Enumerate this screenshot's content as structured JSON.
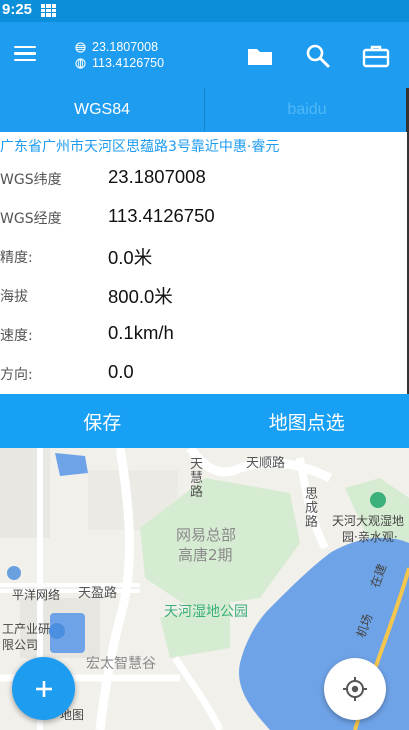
{
  "status_bar": {
    "time": "9:25"
  },
  "app_bar": {
    "latitude": "23.1807008",
    "longitude": "113.4126750",
    "icons": [
      "menu-icon",
      "folder-icon",
      "search-icon",
      "toolbox-icon"
    ]
  },
  "tabs": [
    {
      "label": "WGS84",
      "active": true
    },
    {
      "label": "baidu",
      "active": false
    }
  ],
  "info": {
    "address": "广东省广州市天河区思蕴路3号靠近中惠·睿元",
    "fields": [
      {
        "label": "WGS纬度",
        "value": "23.1807008"
      },
      {
        "label": "WGS经度",
        "value": "113.4126750"
      },
      {
        "label": "精度:",
        "value": "0.0米"
      },
      {
        "label": "海拔",
        "value": "800.0米"
      },
      {
        "label": "速度:",
        "value": "0.1km/h"
      },
      {
        "label": "方向:",
        "value": "0.0"
      }
    ]
  },
  "actions": {
    "save": "保存",
    "pick_on_map": "地图点选"
  },
  "map": {
    "labels": {
      "tianshun_road": "天顺路",
      "tianhui_road": "天慧路",
      "sicheng_road": "思成路",
      "netease_1": "网易总部",
      "netease_2": "高唐2期",
      "wetland_park": "天河湿地公园",
      "tianhe_daguan_1": "天河大观湿地",
      "tianhe_daguan_2": "园·亲水观·",
      "pacific_net": "平洋网络",
      "tianying_road": "天盈路",
      "industry_1": "工产业研",
      "industry_2": "限公司",
      "hongtai": "宏太智慧谷",
      "map_label": "地图",
      "metro_1": "在建",
      "metro_2": "机场"
    }
  },
  "colors": {
    "primary": "#1e9cf0",
    "status_bar": "#0b8fd8",
    "address": "#1e9cf0",
    "water": "#6fa3e8",
    "park": "#d6ecd2"
  }
}
